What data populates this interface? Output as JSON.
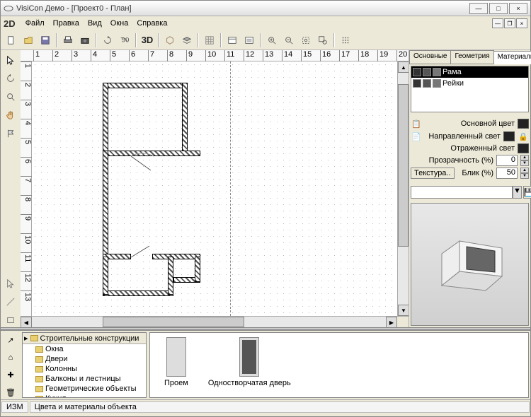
{
  "window": {
    "title": "VisiCon Демо - [Проект0 - План]"
  },
  "mode_label": "2D",
  "menu": {
    "file": "Файл",
    "edit": "Правка",
    "view": "Вид",
    "windows": "Окна",
    "help": "Справка"
  },
  "toolbar3d": "3D",
  "ruler_h": [
    "1",
    "2",
    "3",
    "4",
    "5",
    "6",
    "7",
    "8",
    "9",
    "10",
    "11",
    "12",
    "13",
    "14",
    "15",
    "16",
    "17",
    "18",
    "19",
    "20"
  ],
  "ruler_v": [
    "1",
    "2",
    "3",
    "4",
    "5",
    "6",
    "7",
    "8",
    "9",
    "10",
    "11",
    "12",
    "13"
  ],
  "right": {
    "tabs": {
      "main": "Основные",
      "geometry": "Геометрия",
      "materials": "Материалы"
    },
    "mat_items": [
      {
        "name": "Рама"
      },
      {
        "name": "Рейки"
      }
    ],
    "labels": {
      "base_color": "Основной цвет",
      "dir_light": "Направленный свет",
      "refl_light": "Отраженный свет",
      "transparency": "Прозрачность (%)",
      "texture": "Текстура..",
      "spec": "Блик (%)"
    },
    "values": {
      "transparency": "0",
      "spec": "50"
    }
  },
  "tree": {
    "root": "Строительные конструкции",
    "children": [
      "Окна",
      "Двери",
      "Колонны",
      "Балконы и лестницы",
      "Геометрические объекты",
      "Кухня"
    ]
  },
  "gallery": {
    "item1": "Проем",
    "item2": "Одностворчатая дверь"
  },
  "status": {
    "mode": "ИЗМ",
    "hint": "Цвета и материалы объекта"
  }
}
